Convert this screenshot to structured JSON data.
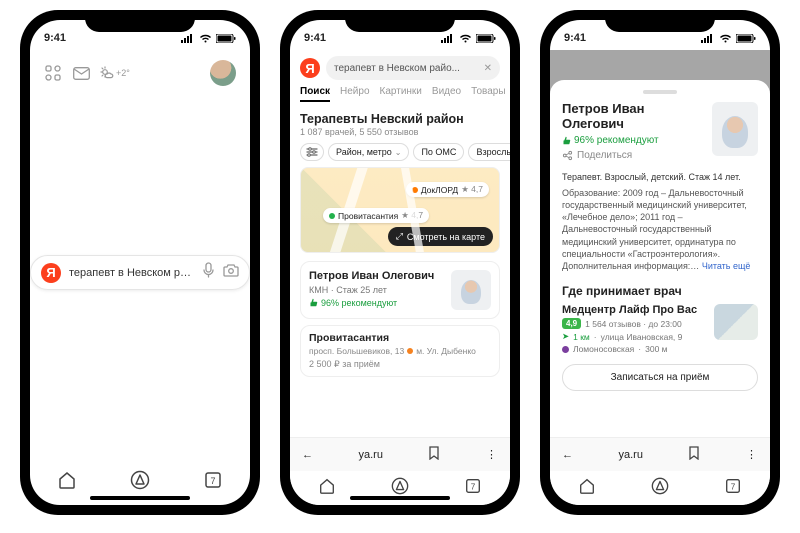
{
  "status": {
    "time": "9:41"
  },
  "phone1": {
    "weather": "+2°",
    "search_query": "терапевт в Невском ра..."
  },
  "phone2": {
    "search_query": "терапевт в Невском райо...",
    "tabs": {
      "search": "Поиск",
      "neuro": "Нейро",
      "images": "Картинки",
      "video": "Видео",
      "goods": "Товары"
    },
    "results_title": "Терапевты Невский район",
    "results_subtitle": "1 087 врачей, 5 550 отзывов",
    "filters": {
      "district": "Район, метро",
      "oms": "По ОМС",
      "adults": "Взрослые и д"
    },
    "map": {
      "poi1_name": "ДокЛОРД",
      "poi1_rating": "★ 4,7",
      "poi2_name": "Провитасантия",
      "poi2_rating": "★ 4,7",
      "open_button": "Смотреть на карте"
    },
    "doctor": {
      "name": "Петров Иван Олегович",
      "title": "КМН · Стаж 25 лет",
      "recommend": "96% рекомендуют"
    },
    "clinic": {
      "name": "Провитасантия",
      "address": "просп. Большевиков, 13",
      "metro": "м. Ул. Дыбенко",
      "price": "2 500 ₽ за приём"
    },
    "browser_url": "ya.ru"
  },
  "phone3": {
    "name": "Петров Иван Олегович",
    "recommend": "96% рекомендуют",
    "share": "Поделиться",
    "summary": "Терапевт. Взрослый, детский. Стаж 14 лет.",
    "bio": "Образование: 2009 год – Дальневосточный государственный медицинский университет, «Лечебное дело»; 2011 год – Дальневосточный государственный медицинский университет, ординатура по специальности «Гастроэнтерология». Дополнительная информация:…",
    "read_more": "Читать ещё",
    "section_where": "Где принимает врач",
    "clinic": {
      "name": "Медцентр Лайф Про Вас",
      "rating": "4,9",
      "reviews": "1 564 отзывов · до 23:00",
      "distance": "1 км",
      "address": "улица Ивановская, 9",
      "metro": "Ломоносовская",
      "metro_dist": "300 м"
    },
    "book": "Записаться на приём",
    "browser_url": "ya.ru"
  }
}
